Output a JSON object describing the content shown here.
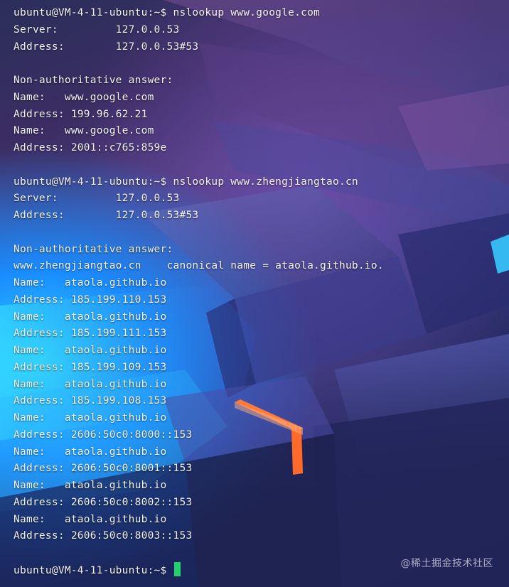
{
  "terminal": {
    "lines": [
      "ubuntu@VM-4-11-ubuntu:~$ nslookup www.google.com",
      "Server:         127.0.0.53",
      "Address:        127.0.0.53#53",
      "",
      "Non-authoritative answer:",
      "Name:   www.google.com",
      "Address: 199.96.62.21",
      "Name:   www.google.com",
      "Address: 2001::c765:859e",
      "",
      "ubuntu@VM-4-11-ubuntu:~$ nslookup www.zhengjiangtao.cn",
      "Server:         127.0.0.53",
      "Address:        127.0.0.53#53",
      "",
      "Non-authoritative answer:",
      "www.zhengjiangtao.cn    canonical name = ataola.github.io.",
      "Name:   ataola.github.io",
      "Address: 185.199.110.153",
      "Name:   ataola.github.io",
      "Address: 185.199.111.153",
      "Name:   ataola.github.io",
      "Address: 185.199.109.153",
      "Name:   ataola.github.io",
      "Address: 185.199.108.153",
      "Name:   ataola.github.io",
      "Address: 2606:50c0:8000::153",
      "Name:   ataola.github.io",
      "Address: 2606:50c0:8001::153",
      "Name:   ataola.github.io",
      "Address: 2606:50c0:8002::153",
      "Name:   ataola.github.io",
      "Address: 2606:50c0:8003::153",
      "",
      "ubuntu@VM-4-11-ubuntu:~$ "
    ],
    "text_color": "#f2f2f6",
    "cursor_color": "#22d36b"
  },
  "watermark": {
    "text": "@稀土掘金技术社区"
  },
  "icons": {
    "cursor": "block-cursor"
  }
}
